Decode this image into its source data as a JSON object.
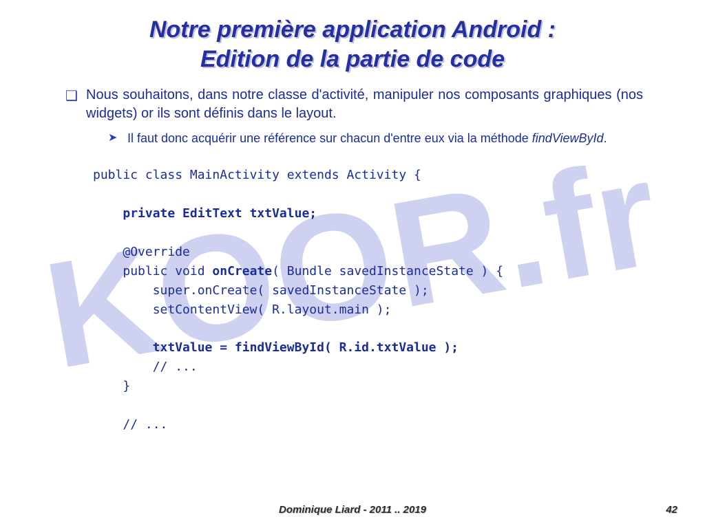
{
  "watermark": "KOOR.fr",
  "title_line1": "Notre première application Android :",
  "title_line2": "Edition de la partie de code",
  "bullet_main": "Nous souhaitons, dans notre classe d'activité, manipuler nos composants graphiques (nos widgets) or ils sont définis dans le layout.",
  "sub_text": "Il faut donc acquérir une référence sur chacun d'entre eux via la méthode ",
  "sub_method": "findViewById",
  "sub_after": ".",
  "code": {
    "l1": "public class MainActivity extends Activity {",
    "l2": "private EditText txtValue;",
    "l3": "@Override",
    "l4a": "public void ",
    "l4b": "onCreate",
    "l4c": "( Bundle savedInstanceState ) {",
    "l5": "super.onCreate( savedInstanceState );",
    "l6": "setContentView( R.layout.main );",
    "l7": "txtValue = findViewById( R.id.txtValue );",
    "l8": "// ...",
    "l9": "}",
    "l10": "// ..."
  },
  "footer_author": "Dominique Liard - 2011 .. 2019",
  "footer_page": "42"
}
